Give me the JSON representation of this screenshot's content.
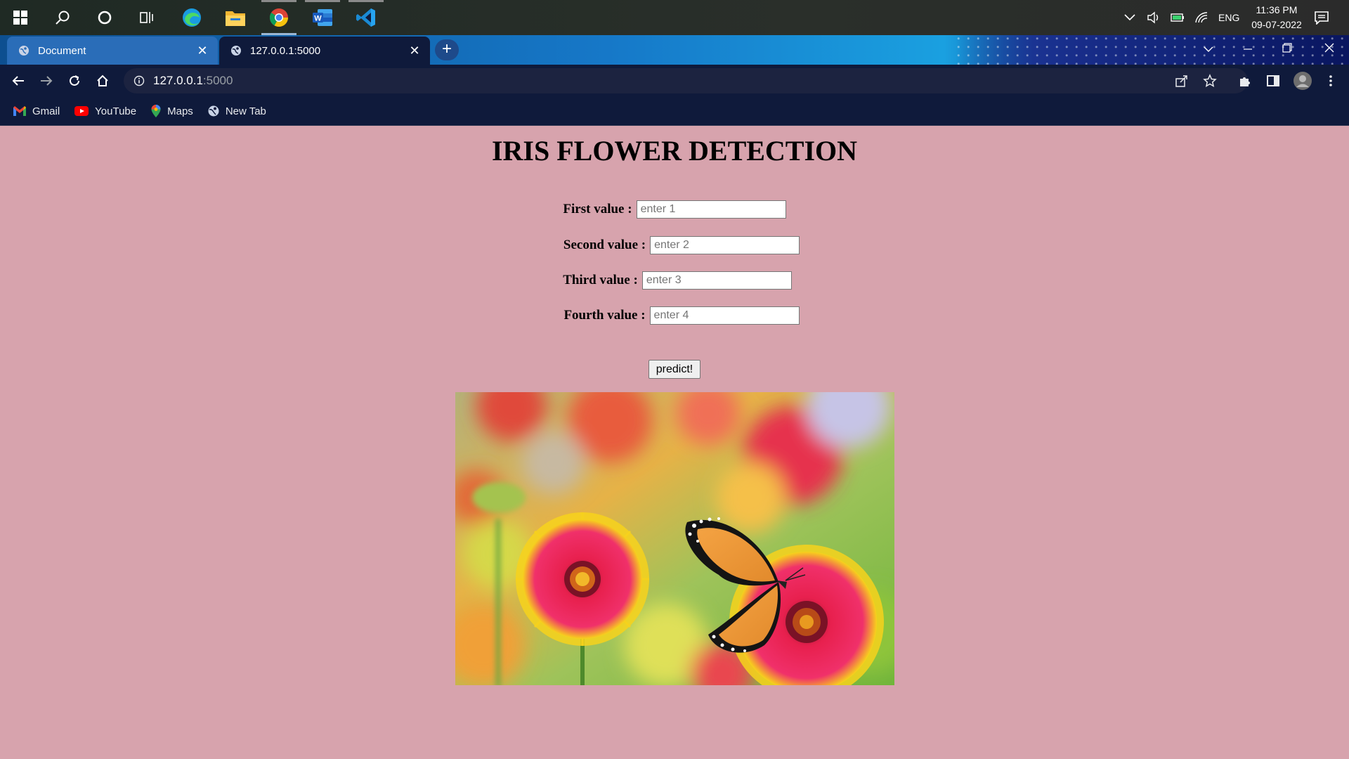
{
  "taskbar": {
    "apps": [
      "Start",
      "Search",
      "Cortana",
      "Task View",
      "Microsoft Edge",
      "File Explorer",
      "Google Chrome",
      "Microsoft Word",
      "Visual Studio Code"
    ],
    "tray": {
      "language": "ENG",
      "time": "11:36 PM",
      "date": "09-07-2022"
    }
  },
  "browser": {
    "tabs": [
      {
        "title": "Document",
        "active": false
      },
      {
        "title": "127.0.0.1:5000",
        "active": true
      }
    ],
    "address": {
      "host": "127.0.0.1",
      "port": ":5000"
    },
    "bookmarks": [
      {
        "label": "Gmail",
        "icon": "gmail-icon"
      },
      {
        "label": "YouTube",
        "icon": "youtube-icon"
      },
      {
        "label": "Maps",
        "icon": "maps-icon"
      },
      {
        "label": "New Tab",
        "icon": "globe-icon"
      }
    ]
  },
  "page": {
    "title": "IRIS FLOWER DETECTION",
    "fields": [
      {
        "label": "First value :",
        "placeholder": "enter 1",
        "value": ""
      },
      {
        "label": "Second value :",
        "placeholder": "enter 2",
        "value": ""
      },
      {
        "label": "Third value :",
        "placeholder": "enter 3",
        "value": ""
      },
      {
        "label": "Fourth value :",
        "placeholder": "enter 4",
        "value": ""
      }
    ],
    "button_label": "predict!",
    "image": "flowers-and-butterfly-photo"
  },
  "colors": {
    "page_background": "#d7a3ad",
    "toolbar": "#0f1a3b"
  }
}
